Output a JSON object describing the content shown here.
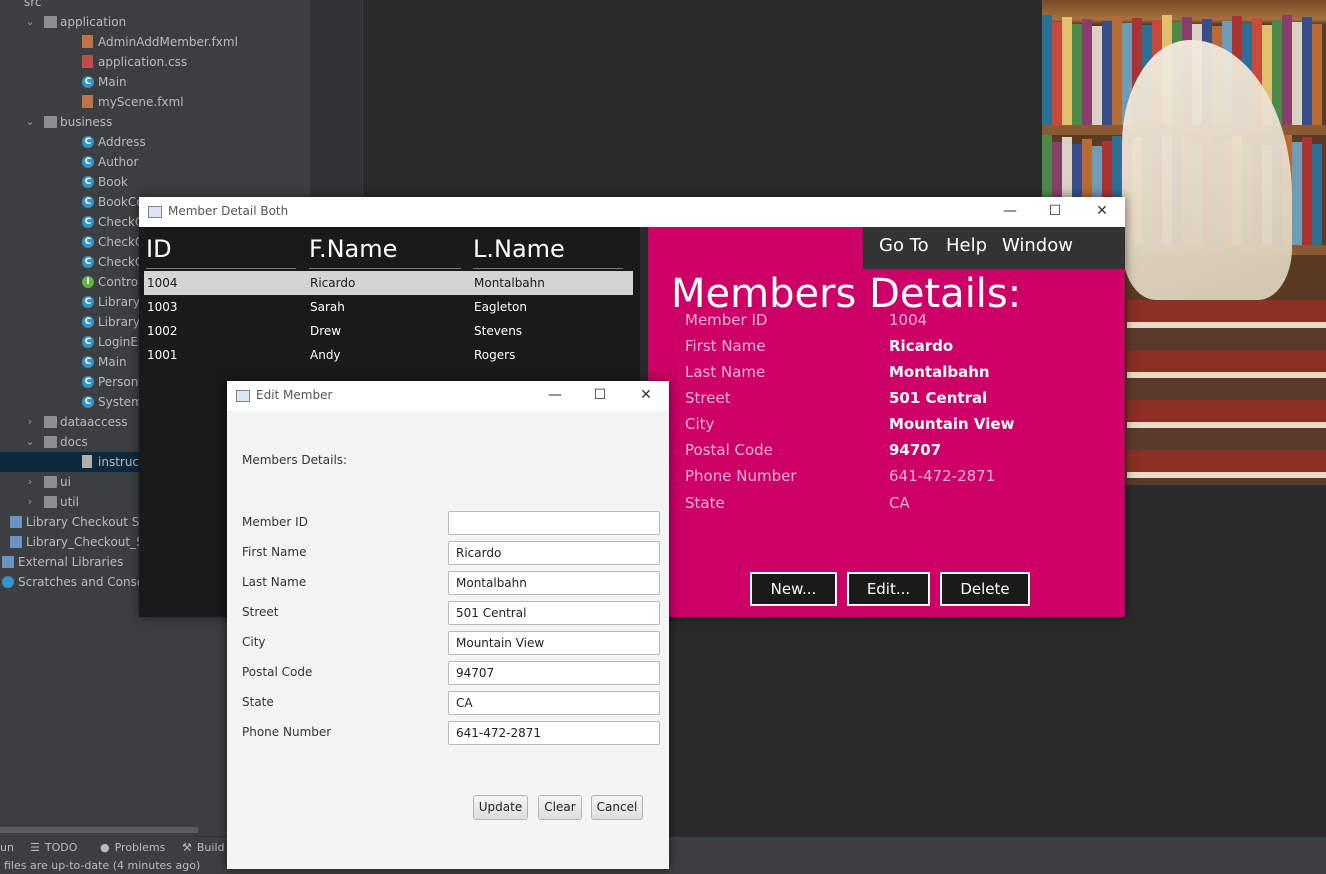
{
  "ide": {
    "tree": [
      {
        "label": "src",
        "icon": "source-folder-icon",
        "type": "src",
        "indent": 0,
        "chevron": ""
      },
      {
        "label": "application",
        "icon": "folder-icon",
        "type": "folder",
        "indent": 1,
        "chevron": "⌄"
      },
      {
        "label": "AdminAddMember.fxml",
        "icon": "fxml-file-icon",
        "type": "fxml",
        "indent": 2,
        "chevron": ""
      },
      {
        "label": "application.css",
        "icon": "css-file-icon",
        "type": "css",
        "indent": 2,
        "chevron": ""
      },
      {
        "label": "Main",
        "icon": "class-icon",
        "type": "cls",
        "indent": 2,
        "chevron": ""
      },
      {
        "label": "myScene.fxml",
        "icon": "fxml-file-icon",
        "type": "fxml",
        "indent": 2,
        "chevron": ""
      },
      {
        "label": "business",
        "icon": "folder-icon",
        "type": "folder",
        "indent": 1,
        "chevron": "⌄"
      },
      {
        "label": "Address",
        "icon": "class-icon",
        "type": "cls",
        "indent": 2,
        "chevron": ""
      },
      {
        "label": "Author",
        "icon": "class-icon",
        "type": "cls",
        "indent": 2,
        "chevron": ""
      },
      {
        "label": "Book",
        "icon": "class-icon",
        "type": "cls",
        "indent": 2,
        "chevron": ""
      },
      {
        "label": "BookCopy",
        "icon": "class-icon",
        "type": "cls",
        "indent": 2,
        "chevron": ""
      },
      {
        "label": "CheckOutEntry",
        "icon": "class-icon",
        "type": "cls",
        "indent": 2,
        "chevron": ""
      },
      {
        "label": "CheckOutRecord",
        "icon": "class-icon",
        "type": "cls",
        "indent": 2,
        "chevron": ""
      },
      {
        "label": "CheckOutRecord",
        "icon": "class-icon",
        "type": "cls",
        "indent": 2,
        "chevron": ""
      },
      {
        "label": "ControllerInterface",
        "icon": "interface-icon",
        "type": "iface",
        "indent": 2,
        "chevron": ""
      },
      {
        "label": "LibraryMember",
        "icon": "class-icon",
        "type": "cls",
        "indent": 2,
        "chevron": ""
      },
      {
        "label": "LibrarySystemException",
        "icon": "class-icon",
        "type": "cls",
        "indent": 2,
        "chevron": ""
      },
      {
        "label": "LoginException",
        "icon": "class-icon",
        "type": "cls",
        "indent": 2,
        "chevron": ""
      },
      {
        "label": "Main",
        "icon": "class-icon",
        "type": "cls",
        "indent": 2,
        "chevron": ""
      },
      {
        "label": "Person",
        "icon": "class-icon",
        "type": "cls",
        "indent": 2,
        "chevron": ""
      },
      {
        "label": "SystemController",
        "icon": "class-icon",
        "type": "cls",
        "indent": 2,
        "chevron": ""
      },
      {
        "label": "dataaccess",
        "icon": "folder-icon",
        "type": "folder",
        "indent": 1,
        "chevron": "›"
      },
      {
        "label": "docs",
        "icon": "folder-icon",
        "type": "folder",
        "indent": 1,
        "chevron": "⌄"
      },
      {
        "label": "instructions.txt",
        "icon": "text-file-icon",
        "type": "txt",
        "indent": 2,
        "chevron": "",
        "selected": true
      },
      {
        "label": "ui",
        "icon": "folder-icon",
        "type": "folder",
        "indent": 1,
        "chevron": "›"
      },
      {
        "label": "util",
        "icon": "folder-icon",
        "type": "folder",
        "indent": 1,
        "chevron": "›"
      },
      {
        "label": "Library Checkout System",
        "icon": "module-file-icon",
        "type": "lib",
        "indent": 0,
        "chevron": ""
      },
      {
        "label": "Library_Checkout_System",
        "icon": "module-file-icon",
        "type": "lib",
        "indent": 0,
        "chevron": ""
      },
      {
        "label": "External Libraries",
        "icon": "libraries-icon",
        "type": "lib",
        "indent": -1,
        "chevron": ""
      },
      {
        "label": "Scratches and Consoles",
        "icon": "scratches-icon",
        "type": "scr",
        "indent": -1,
        "chevron": ""
      }
    ],
    "tool_tabs": [
      {
        "label": "un",
        "icon": ""
      },
      {
        "label": "TODO",
        "icon": "☰"
      },
      {
        "label": "Problems",
        "icon": "●"
      },
      {
        "label": "Build",
        "icon": "⚒"
      }
    ],
    "status": "files are up-to-date (4 minutes ago)"
  },
  "member_detail": {
    "title": "Member Detail Both",
    "controls": {
      "minimize": "—",
      "maximize": "☐",
      "close": "✕"
    },
    "columns": [
      "ID",
      "F.Name",
      "L.Name"
    ],
    "rows": [
      {
        "id": "1004",
        "first": "Ricardo",
        "last": "Montalbahn",
        "selected": true
      },
      {
        "id": "1003",
        "first": "Sarah",
        "last": "Eagleton"
      },
      {
        "id": "1002",
        "first": "Drew",
        "last": "Stevens"
      },
      {
        "id": "1001",
        "first": "Andy",
        "last": "Rogers"
      }
    ],
    "menu": [
      "Go To",
      "Help",
      "Window"
    ],
    "heading": "Members Details:",
    "fields": [
      {
        "label": "Member ID",
        "value": "1004",
        "dim": true
      },
      {
        "label": "First Name",
        "value": "Ricardo"
      },
      {
        "label": "Last Name",
        "value": "Montalbahn"
      },
      {
        "label": "Street",
        "value": "501 Central"
      },
      {
        "label": "City",
        "value": "Mountain View"
      },
      {
        "label": "Postal Code",
        "value": "94707"
      },
      {
        "label": "Phone Number",
        "value": "641-472-2871",
        "dim": true
      },
      {
        "label": "State",
        "value": "CA",
        "dim": true
      }
    ],
    "buttons": {
      "new": "New...",
      "edit": "Edit...",
      "delete": "Delete"
    },
    "colors": {
      "accent": "#cc0066",
      "dark": "#1a1a1a"
    }
  },
  "edit_member": {
    "title": "Edit Member",
    "heading": "Members Details:",
    "fields": [
      {
        "label": "Member ID",
        "value": ""
      },
      {
        "label": "First Name",
        "value": "Ricardo"
      },
      {
        "label": "Last Name",
        "value": "Montalbahn"
      },
      {
        "label": "Street",
        "value": "501 Central"
      },
      {
        "label": "City",
        "value": "Mountain View"
      },
      {
        "label": "Postal Code",
        "value": "94707"
      },
      {
        "label": "State",
        "value": "CA"
      },
      {
        "label": "Phone Number",
        "value": "641-472-2871"
      }
    ],
    "buttons": {
      "update": "Update",
      "clear": "Clear",
      "cancel": "Cancel"
    }
  }
}
